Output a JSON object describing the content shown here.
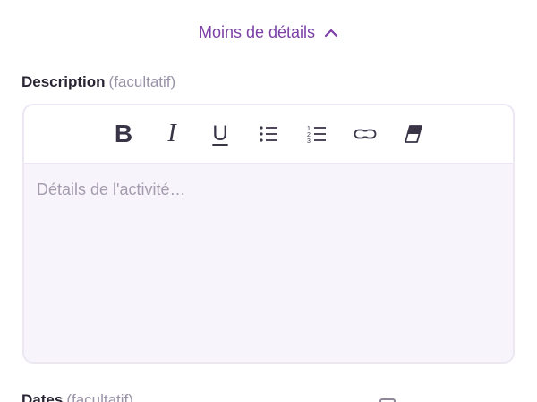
{
  "details_toggle": {
    "label": "Moins de détails",
    "icon": "chevron-up-icon",
    "color": "#7b3fa6"
  },
  "description": {
    "label": "Description",
    "optional": "(facultatif)",
    "placeholder": "Détails de l'activité…",
    "value": "",
    "toolbar": [
      {
        "name": "bold-button",
        "label": "B",
        "icon": "bold-icon"
      },
      {
        "name": "italic-button",
        "label": "I",
        "icon": "italic-icon"
      },
      {
        "name": "underline-button",
        "label": "U",
        "icon": "underline-icon"
      },
      {
        "name": "bullet-list-button",
        "icon": "bullet-list-icon"
      },
      {
        "name": "numbered-list-button",
        "icon": "numbered-list-icon"
      },
      {
        "name": "link-button",
        "icon": "link-icon"
      },
      {
        "name": "clear-format-button",
        "icon": "eraser-icon"
      }
    ]
  },
  "dates": {
    "label": "Dates",
    "optional": "(facultatif)"
  }
}
